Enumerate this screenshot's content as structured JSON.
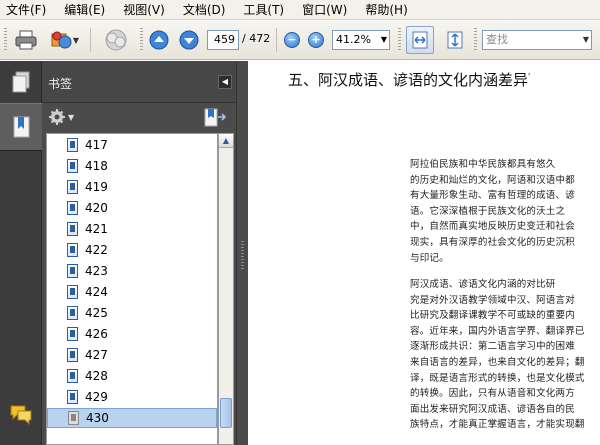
{
  "menu": {
    "items": [
      "文件(F)",
      "编辑(E)",
      "视图(V)",
      "文档(D)",
      "工具(T)",
      "窗口(W)",
      "帮助(H)"
    ]
  },
  "toolbar": {
    "icons": [
      "print-icon",
      "share-icon",
      "stamp-icon",
      "prev-page-icon",
      "next-page-icon",
      "zoom-out-icon",
      "zoom-in-icon",
      "fit-width-icon",
      "fit-page-icon"
    ],
    "current_page": "459",
    "page_total": "/ 472",
    "zoom_level": "41.2%",
    "search_placeholder": "查找"
  },
  "side_panel": {
    "title": "书签",
    "bookmarks": [
      "417",
      "418",
      "419",
      "420",
      "421",
      "422",
      "423",
      "424",
      "425",
      "426",
      "427",
      "428",
      "429",
      "430"
    ],
    "selected": "430"
  },
  "document": {
    "heading": "五、阿汉成语、谚语的文化内涵差异",
    "heading_mark": "'",
    "paragraph1": [
      "阿拉伯民族和中华民族都具有悠久",
      "的历史和灿烂的文化，阿语和汉语中都",
      "有大量形象生动、富有哲理的成语、谚",
      "语。它深深植根于民族文化的沃土之",
      "中，自然而真实地反映历史变迁和社会",
      "现实，具有深厚的社会文化的历史沉积",
      "与印记。"
    ],
    "paragraph2": [
      "阿汉成语、谚语文化内涵的对比研",
      "究是对外汉语教学领域中汉、阿语言对",
      "比研究及翻译课教学不可或缺的重要内",
      "容。近年来，国内外语言学界、翻译界已",
      "逐渐形成共识：第二语言学习中的困难",
      "来自语言的差异，也来自文化的差异；翻",
      "译，既是语言形式的转换，也是文化模式",
      "的转换。因此，只有从语音和文化两方",
      "面出发来研究阿汉成语、谚语各自的民",
      "族特点，才能真正掌握语言，才能实现翻"
    ]
  },
  "colors": {
    "panel_bg": "#4b4b4b",
    "selection": "#b9d3ef",
    "accent": "#2f73c9"
  }
}
